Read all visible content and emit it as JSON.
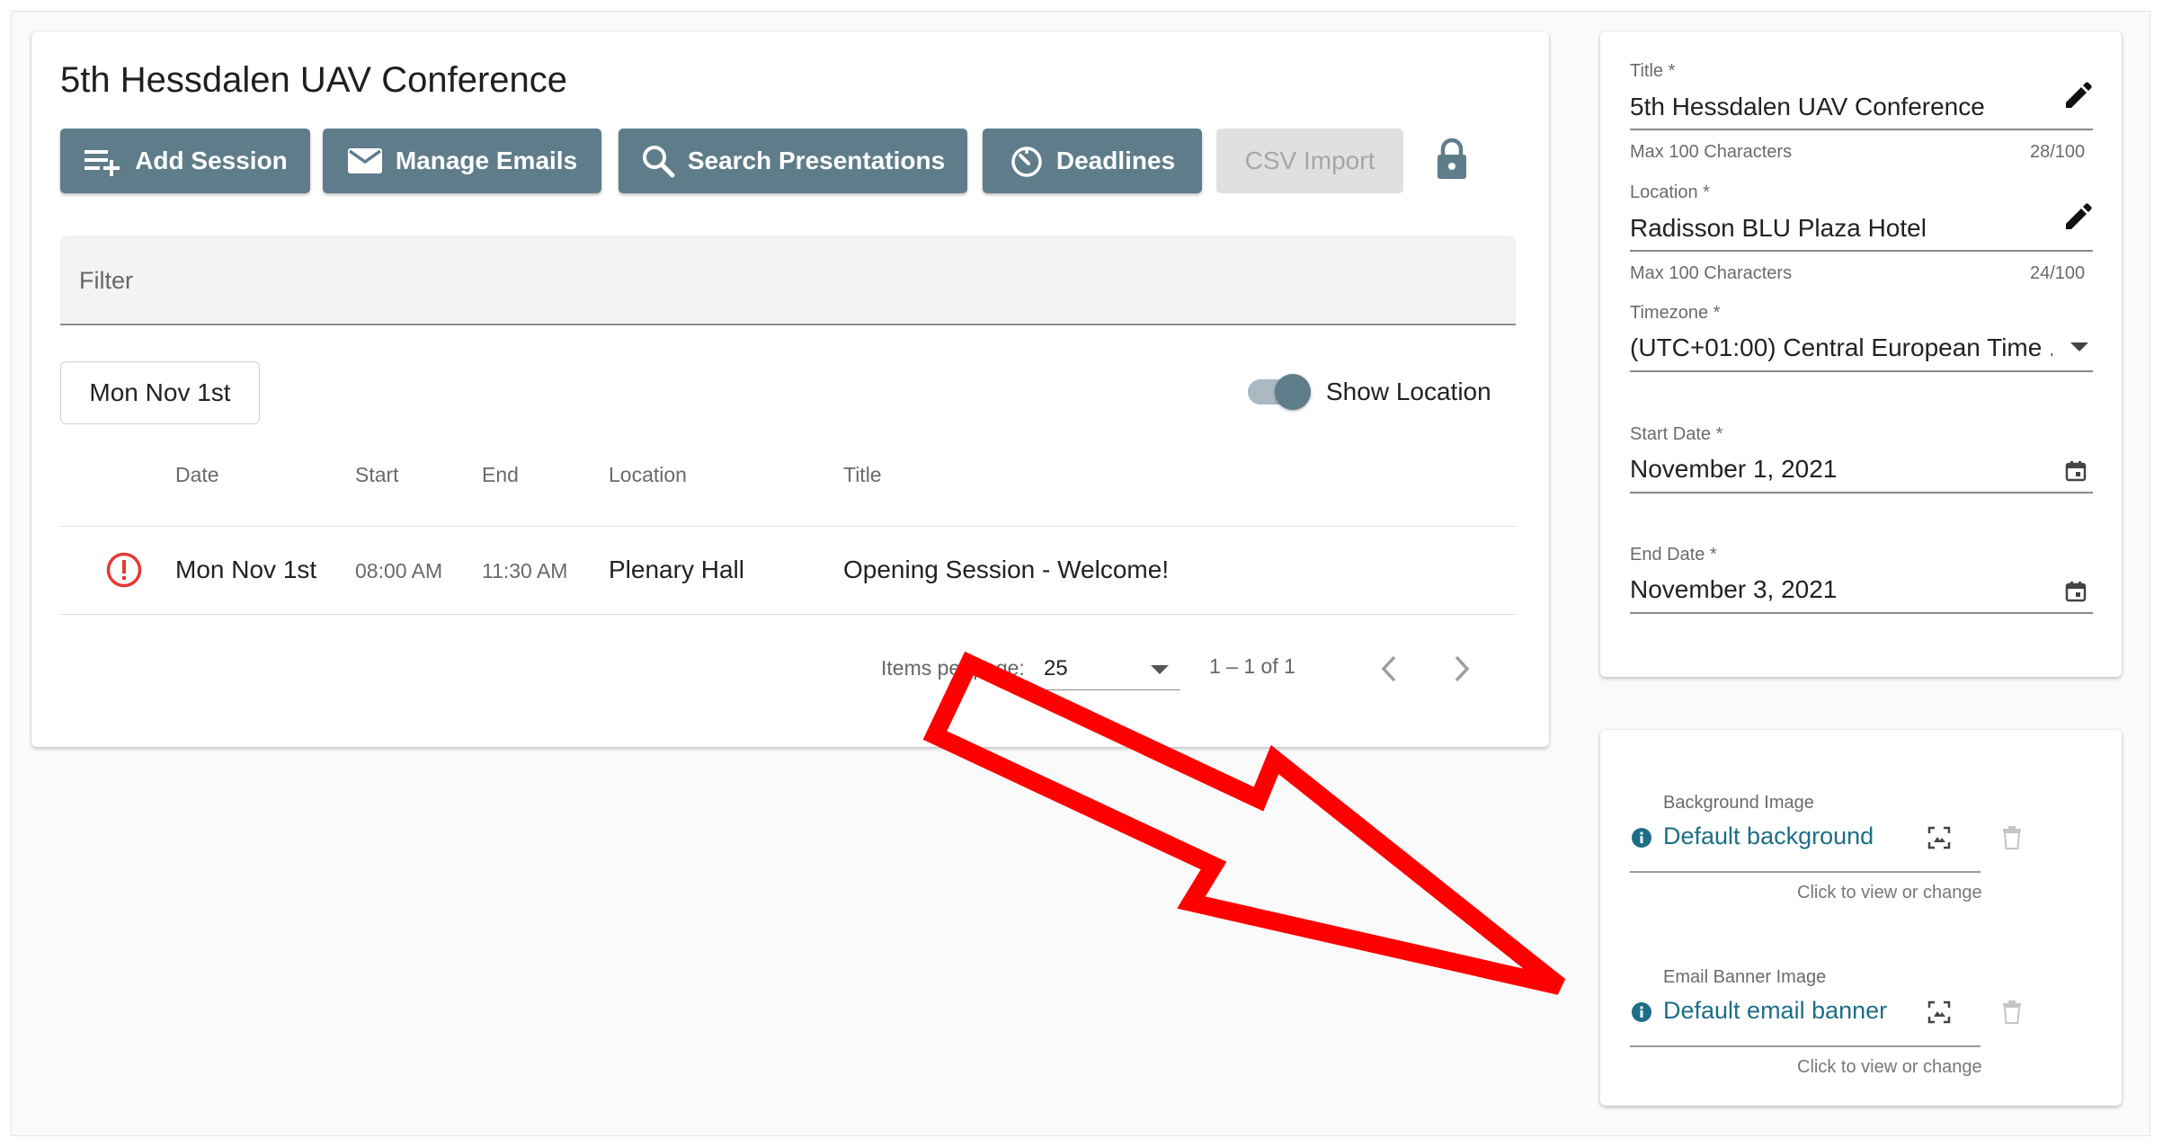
{
  "header": {
    "title": "5th Hessdalen UAV Conference"
  },
  "toolbar": {
    "add_session": "Add Session",
    "manage_emails": "Manage Emails",
    "search_presentations": "Search Presentations",
    "deadlines": "Deadlines",
    "csv_import": "CSV Import",
    "lock_icon": "lock-icon"
  },
  "filter": {
    "label": "Filter"
  },
  "day_chip": {
    "label": "Mon Nov 1st"
  },
  "show_location": {
    "label": "Show Location",
    "on": true
  },
  "table": {
    "columns": [
      "Date",
      "Start",
      "End",
      "Location",
      "Title"
    ],
    "rows": [
      {
        "date": "Mon Nov 1st",
        "start": "08:00 AM",
        "end": "11:30 AM",
        "location": "Plenary Hall",
        "title": "Opening Session - Welcome!",
        "status_icon": "error-icon"
      }
    ]
  },
  "paginator": {
    "items_per_page_label": "Items per page:",
    "page_size": "25",
    "range": "1 – 1 of 1"
  },
  "form": {
    "title": {
      "label": "Title *",
      "value": "5th Hessdalen UAV Conference",
      "hint": "Max 100 Characters",
      "count": "28/100"
    },
    "location": {
      "label": "Location *",
      "value": "Radisson BLU Plaza Hotel",
      "hint": "Max 100 Characters",
      "count": "24/100"
    },
    "timezone": {
      "label": "Timezone *",
      "value": "(UTC+01:00) Central European Time ..."
    },
    "start_date": {
      "label": "Start Date *",
      "value": "November 1, 2021"
    },
    "end_date": {
      "label": "End Date *",
      "value": "November 3, 2021"
    }
  },
  "images": {
    "background": {
      "label": "Background Image",
      "value": "Default background",
      "hint": "Click to view or change"
    },
    "email_banner": {
      "label": "Email Banner Image",
      "value": "Default email banner",
      "hint": "Click to view or change"
    }
  },
  "colors": {
    "primary": "#5f7c8a",
    "error": "#e53935",
    "link": "#1d6e87",
    "annotation_arrow": "#ff0000"
  }
}
